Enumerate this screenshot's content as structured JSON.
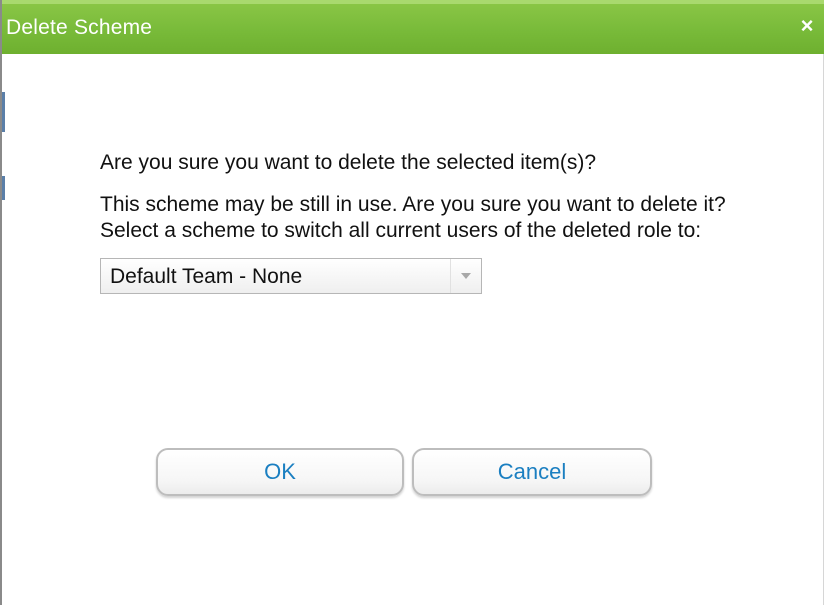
{
  "dialog": {
    "title": "Delete Scheme",
    "close_label": "×",
    "question": "Are you sure you want to delete the selected item(s)?",
    "warning": "This scheme may be still in use. Are you sure you want to delete it? Select a scheme to switch all current users of the deleted role to:",
    "select": {
      "selected": "Default Team - None"
    },
    "buttons": {
      "ok": "OK",
      "cancel": "Cancel"
    }
  },
  "colors": {
    "titlebar": "#79bb3a",
    "button_text": "#1b7fc1"
  }
}
